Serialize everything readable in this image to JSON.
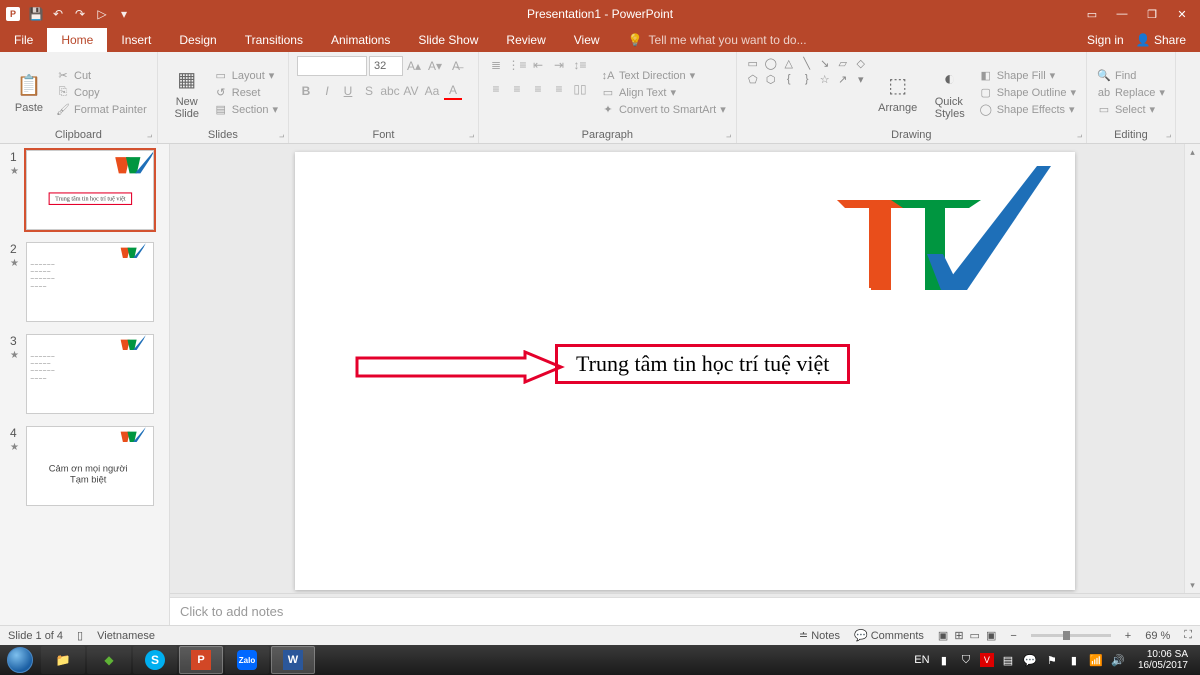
{
  "title": "Presentation1 - PowerPoint",
  "qat": {
    "save": "💾",
    "undo": "↶",
    "redo": "↷",
    "start": "▷"
  },
  "tabs": {
    "file": "File",
    "home": "Home",
    "insert": "Insert",
    "design": "Design",
    "transitions": "Transitions",
    "animations": "Animations",
    "slideshow": "Slide Show",
    "review": "Review",
    "view": "View",
    "tellme": "Tell me what you want to do...",
    "signin": "Sign in",
    "share": "Share"
  },
  "ribbon": {
    "clipboard": {
      "label": "Clipboard",
      "paste": "Paste",
      "cut": "Cut",
      "copy": "Copy",
      "fmt": "Format Painter"
    },
    "slides": {
      "label": "Slides",
      "new": "New\nSlide",
      "layout": "Layout",
      "reset": "Reset",
      "section": "Section"
    },
    "font": {
      "label": "Font",
      "size": "32"
    },
    "paragraph": {
      "label": "Paragraph",
      "textdir": "Text Direction",
      "align": "Align Text",
      "smart": "Convert to SmartArt"
    },
    "drawing": {
      "label": "Drawing",
      "arrange": "Arrange",
      "quick": "Quick\nStyles",
      "fill": "Shape Fill",
      "outline": "Shape Outline",
      "effects": "Shape Effects"
    },
    "editing": {
      "label": "Editing",
      "find": "Find",
      "replace": "Replace",
      "select": "Select"
    }
  },
  "thumbs": [
    "1",
    "2",
    "3",
    "4"
  ],
  "slide1": {
    "text": "Trung tâm tin học trí tuệ việt"
  },
  "slide4": {
    "line1": "Cảm ơn mọi người",
    "line2": "Tạm biệt"
  },
  "notes_placeholder": "Click to add notes",
  "status": {
    "slide": "Slide 1 of 4",
    "lang": "Vietnamese",
    "notes": "Notes",
    "comments": "Comments",
    "zoom": "69 %"
  },
  "tray": {
    "lang": "EN",
    "time": "10:06 SA",
    "date": "16/05/2017"
  }
}
